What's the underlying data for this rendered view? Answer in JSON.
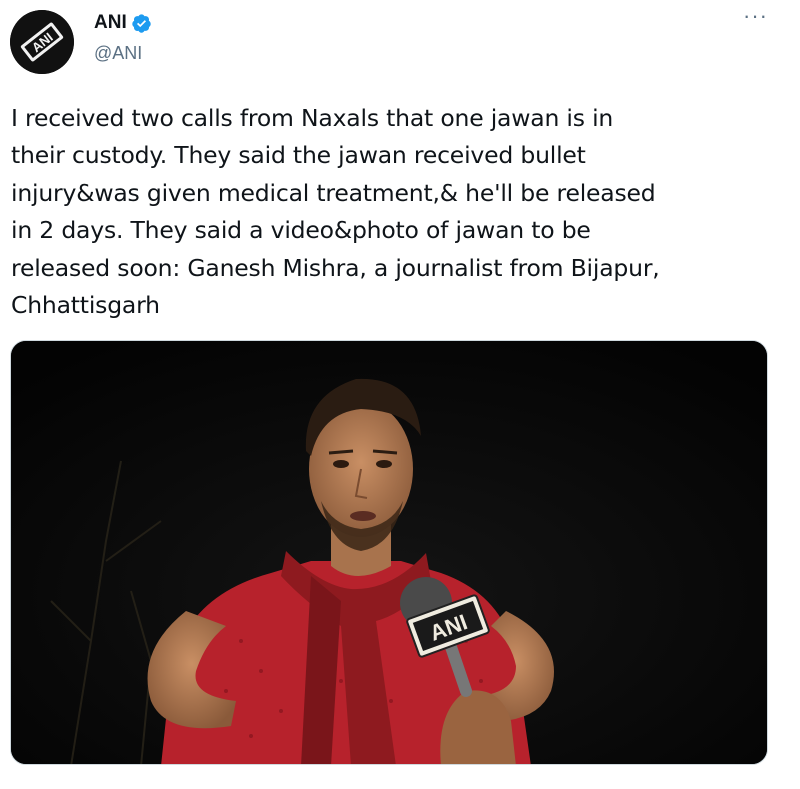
{
  "account": {
    "display_name": "ANI",
    "handle": "@ANI",
    "verified": true,
    "avatar_logo_text": "ANI"
  },
  "tweet": {
    "text": "I received two calls from Naxals that one jawan is in\ntheir custody. They said the jawan received bullet\ninjury&was given medical treatment,& he'll be released\nin 2 days. They said a video&photo of jawan to be\nreleased soon: Ganesh Mishra, a journalist from Bijapur,\nChhattisgarh"
  },
  "media": {
    "microphone_logo_text": "ANI",
    "description_icon": "man-speaking-into-microphone-photo"
  },
  "menu": {
    "more_label": "···"
  },
  "colors": {
    "verified_blue": "#1d9bf0",
    "handle_gray": "#5b7083",
    "shirt_red": "#b7222c",
    "scarf_red": "#8e1a1f"
  }
}
